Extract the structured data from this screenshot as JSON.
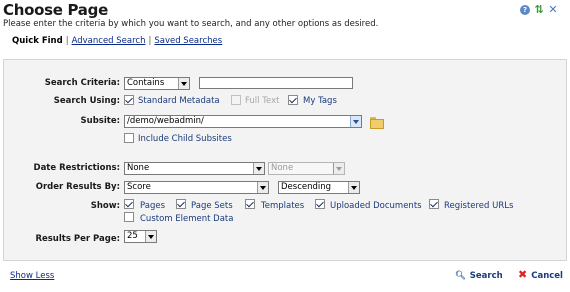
{
  "header": {
    "title": "Choose Page",
    "subtitle": "Please enter the criteria by which you want to search, and any other options as desired."
  },
  "tabs": [
    {
      "label": "Quick Find",
      "active": true
    },
    {
      "label": "Advanced Search",
      "active": false
    },
    {
      "label": "Saved Searches",
      "active": false
    }
  ],
  "form": {
    "search_criteria": {
      "label": "Search Criteria:",
      "mode": "Contains",
      "value": ""
    },
    "search_using": {
      "label": "Search Using:",
      "options": [
        {
          "label": "Standard Metadata",
          "checked": true,
          "disabled": false
        },
        {
          "label": "Full Text",
          "checked": false,
          "disabled": true
        },
        {
          "label": "My Tags",
          "checked": true,
          "disabled": false
        }
      ]
    },
    "subsite": {
      "label": "Subsite:",
      "value": "/demo/webadmin/",
      "include_child_label": "Include Child Subsites",
      "include_child": false
    },
    "date_restrictions": {
      "label": "Date Restrictions:",
      "value": "None",
      "secondary": "None"
    },
    "order_results": {
      "label": "Order Results By:",
      "field": "Score",
      "direction": "Descending"
    },
    "show": {
      "label": "Show:",
      "options": [
        {
          "label": "Pages",
          "checked": true
        },
        {
          "label": "Page Sets",
          "checked": true
        },
        {
          "label": "Templates",
          "checked": true
        },
        {
          "label": "Uploaded Documents",
          "checked": true
        },
        {
          "label": "Registered URLs",
          "checked": true
        },
        {
          "label": "Custom Element Data",
          "checked": false
        }
      ]
    },
    "results_per_page": {
      "label": "Results Per Page:",
      "value": "25"
    }
  },
  "footer": {
    "show_less": "Show Less",
    "search": "Search",
    "cancel": "Cancel"
  },
  "icons": {
    "help": "help-icon",
    "refresh": "refresh-icon",
    "close": "close-icon",
    "folder": "folder-icon",
    "search": "magnifier-icon",
    "cancel": "red-x-icon"
  },
  "colors": {
    "link": "#0a2a8a",
    "panel_bg": "#f3f3f3",
    "cancel_x": "#dd2222"
  }
}
